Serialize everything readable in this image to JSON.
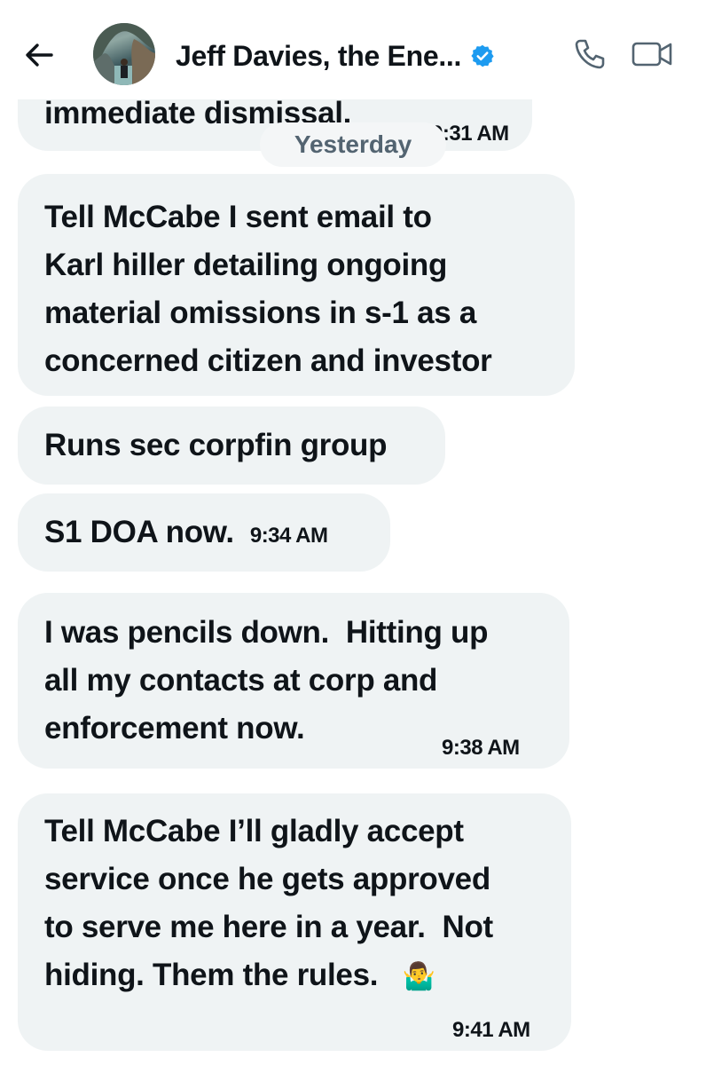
{
  "header": {
    "contact_name": "Jeff Davies, the Ene...",
    "icons": {
      "back": "arrow-left-icon",
      "verified": "verified-badge-icon",
      "call": "phone-icon",
      "video": "video-camera-icon"
    },
    "accent_color": "#1d9bf0"
  },
  "conversation": {
    "date_separator": "Yesterday",
    "messages": [
      {
        "lines": [
          "immediate dismissal."
        ],
        "time": "9:31 AM"
      },
      {
        "lines": [
          "Tell McCabe I sent email to",
          "Karl hiller detailing ongoing",
          "material omissions in s-1 as a",
          "concerned citizen and investor"
        ],
        "time": ""
      },
      {
        "lines": [
          "Runs sec corpfin group"
        ],
        "time": ""
      },
      {
        "lines": [
          "S1 DOA now."
        ],
        "time": "9:34 AM"
      },
      {
        "lines": [
          "I was pencils down.  Hitting up",
          "all my contacts at corp and",
          "enforcement now."
        ],
        "time": "9:38 AM"
      },
      {
        "lines": [
          "Tell McCabe I’ll gladly accept",
          "service once he gets approved",
          "to serve me here in a year.  Not",
          "hiding. Them the rules."
        ],
        "emoji": "🤷‍♂️",
        "time": "9:41 AM"
      }
    ]
  },
  "colors": {
    "bubble_bg": "#eff3f4",
    "text": "#0f1419",
    "muted": "#536471"
  }
}
